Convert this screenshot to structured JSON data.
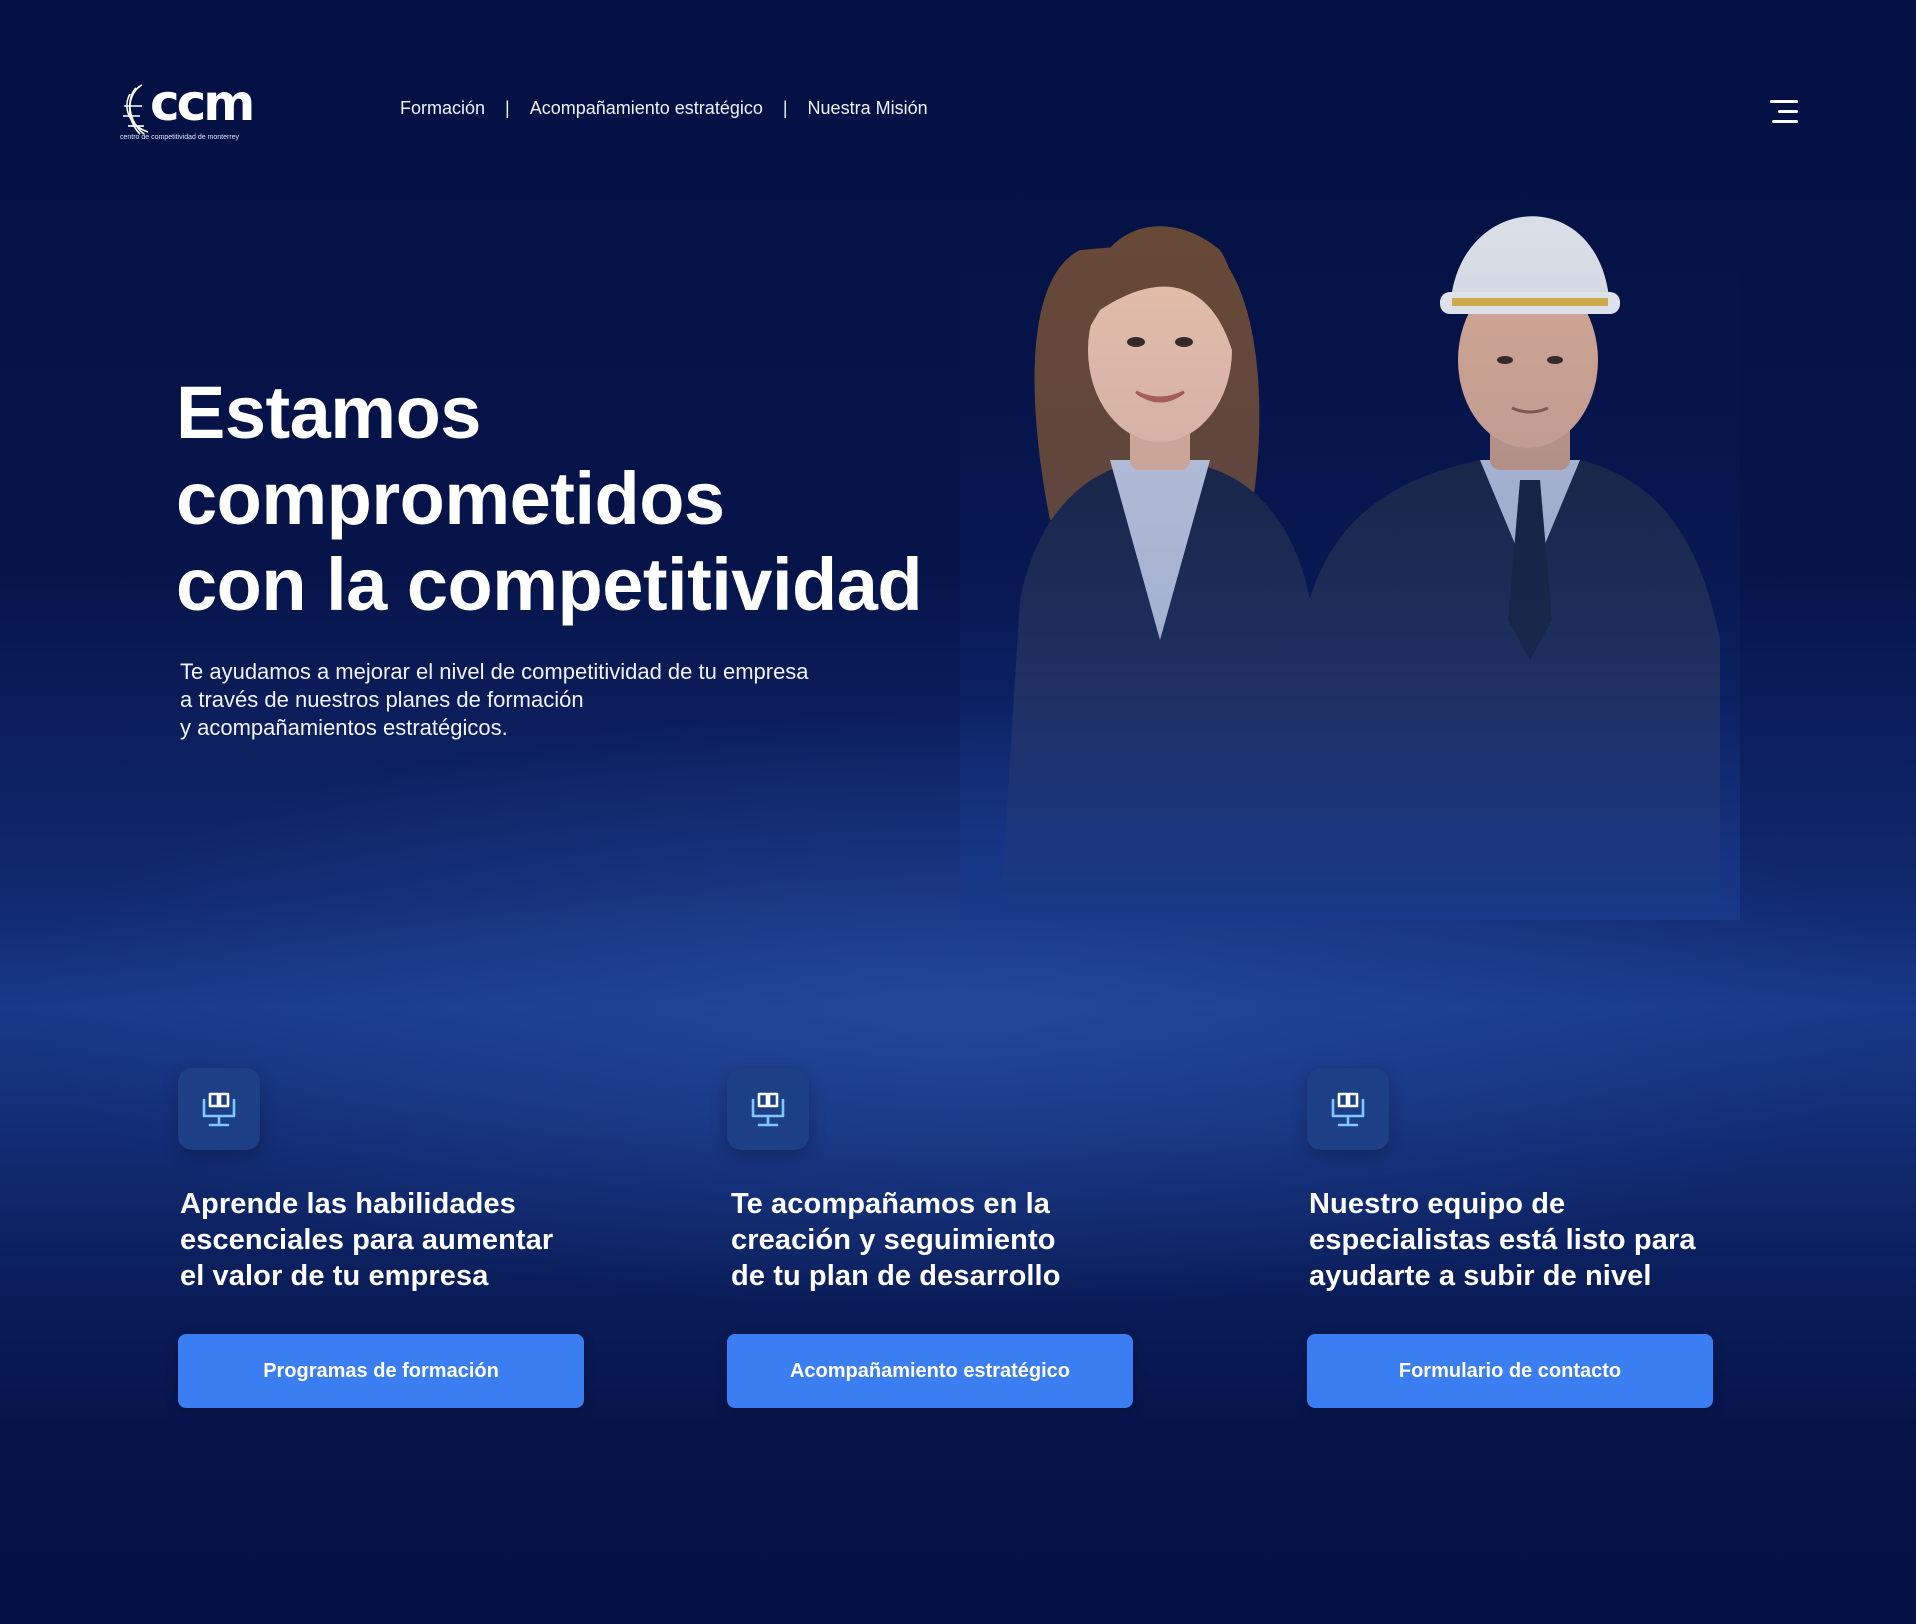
{
  "brand": {
    "name": "ccm",
    "tagline": "centro de competitividad de monterrey"
  },
  "nav": {
    "items": [
      {
        "label": "Formación"
      },
      {
        "label": "Acompañamiento estratégico"
      },
      {
        "label": "Nuestra Misión"
      }
    ],
    "separator": "|"
  },
  "menu_icon": "hamburger-menu-icon",
  "hero": {
    "title_lines": [
      "Estamos",
      "comprometidos",
      "con la competitividad"
    ],
    "subtitle_lines": [
      "Te ayudamos a mejorar el nivel de competitividad de tu empresa",
      "a través de nuestros planes de formación",
      "y acompañamientos estratégicos."
    ]
  },
  "features": [
    {
      "icon": "monitor-book-icon",
      "title_lines": [
        "Aprende las habilidades",
        "escenciales para aumentar",
        "el valor de tu empresa"
      ],
      "button_label": "Programas de formación"
    },
    {
      "icon": "monitor-book-icon",
      "title_lines": [
        "Te acompañamos en la",
        "creación y seguimiento",
        "de tu plan de desarrollo"
      ],
      "button_label": "Acompañamiento estratégico"
    },
    {
      "icon": "monitor-book-icon",
      "title_lines": [
        "Nuestro equipo de",
        "especialistas está listo para",
        "ayudarte a subir de nivel"
      ],
      "button_label": "Formulario de contacto"
    }
  ],
  "colors": {
    "background": "#041042",
    "accent_button": "#3b7ef2",
    "icon_tile": "#1d3f86",
    "icon_stroke": "#7fc8ff"
  }
}
